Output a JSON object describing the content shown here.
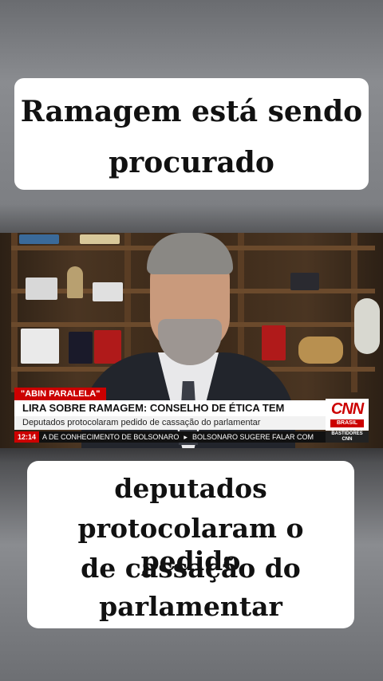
{
  "caption_top": {
    "line1": "Ramagem está sendo",
    "line2": "procurado"
  },
  "caption_bottom": {
    "line1": "deputados",
    "line2": "protocolaram o pedido",
    "line3": "de cassação do",
    "line4": "parlamentar"
  },
  "video": {
    "tag": "\"ABIN PARALELA\"",
    "headline": "LIRA SOBRE RAMAGEM: CONSELHO DE ÉTICA TEM AUTONOMIA",
    "subline": "Deputados protocolaram pedido de cassação do parlamentar",
    "logo": {
      "cnn": "CNN",
      "country": "BRASIL"
    },
    "ticker": {
      "time": "12:14",
      "text1": "A DE CONHECIMENTO DE BOLSONARO",
      "separator": "▸",
      "text2": "BOLSONARO SUGERE FALAR COM"
    },
    "program": {
      "line1": "BASTIDORES",
      "line2": "CNN"
    }
  },
  "colors": {
    "cnn_red": "#cc0000",
    "caption_bg": "#ffffff"
  }
}
